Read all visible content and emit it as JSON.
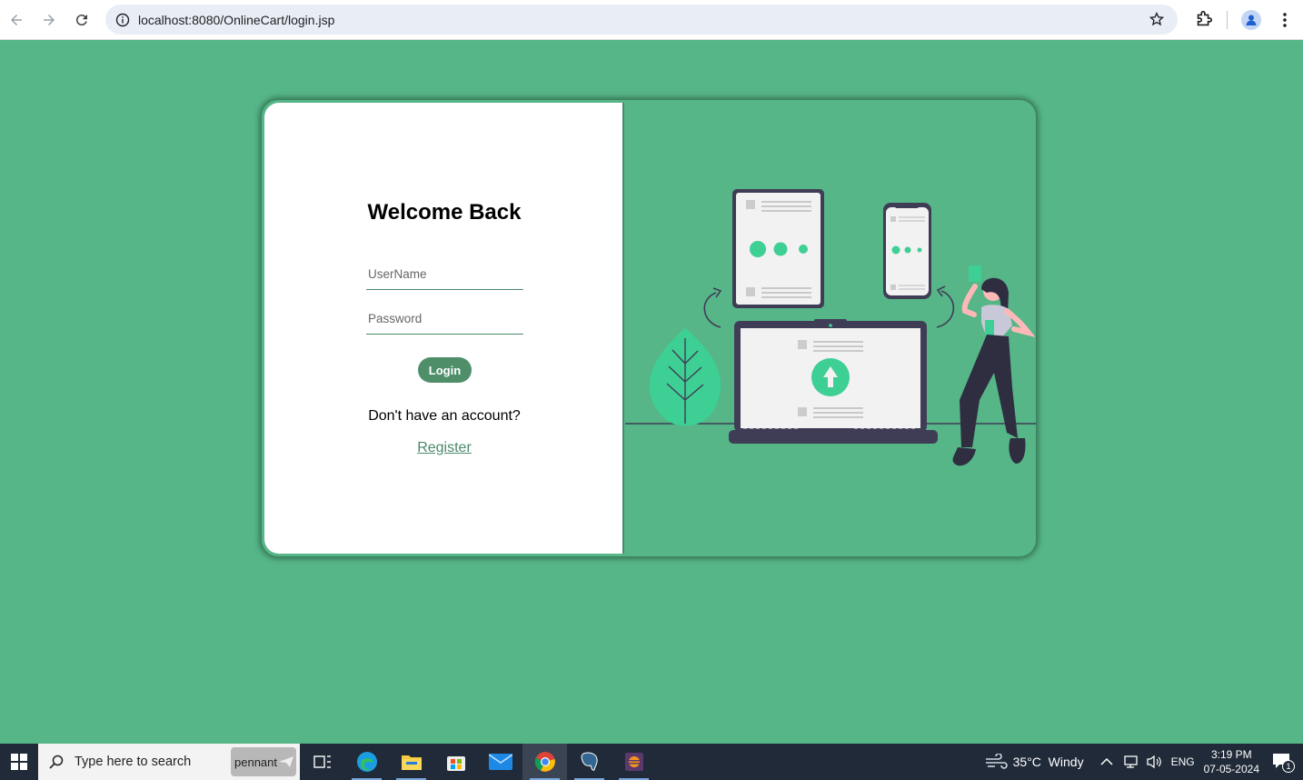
{
  "browser": {
    "url": "localhost:8080/OnlineCart/login.jsp"
  },
  "login": {
    "title": "Welcome Back",
    "username_placeholder": "UserName",
    "password_placeholder": "Password",
    "login_label": "Login",
    "no_account_text": "Don't have an account?",
    "register_label": "Register"
  },
  "taskbar": {
    "search_placeholder": "Type here to search",
    "pennant_label": "pennant",
    "weather": "35°C  Windy",
    "language": "ENG",
    "time": "3:19 PM",
    "date": "07-05-2024",
    "notification_count": "1"
  },
  "colors": {
    "page_background": "#56b688",
    "accent": "#4e8f6a",
    "illustration_accent": "#3ecf94"
  }
}
